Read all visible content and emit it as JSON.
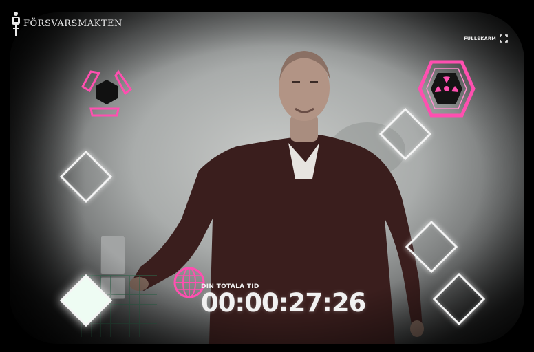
{
  "brand": {
    "name": "FÖRSVARSMAKTEN"
  },
  "controls": {
    "fullscreen_label": "FULLSKÄRM"
  },
  "timer": {
    "label": "DIN TOTALA TID",
    "value": "00:00:27:26"
  },
  "colors": {
    "accent": "#ff4fb0",
    "target_outline": "#f4f4f4",
    "target_filled": "#eefcf3",
    "grid": "#2f6b4e"
  },
  "icons": {
    "logo": "crest-icon",
    "fullscreen": "expand-icon",
    "left_target": "hexagon-triangles-icon",
    "right_target": "hazard-hexagon-icon",
    "globe": "globe-icon"
  }
}
